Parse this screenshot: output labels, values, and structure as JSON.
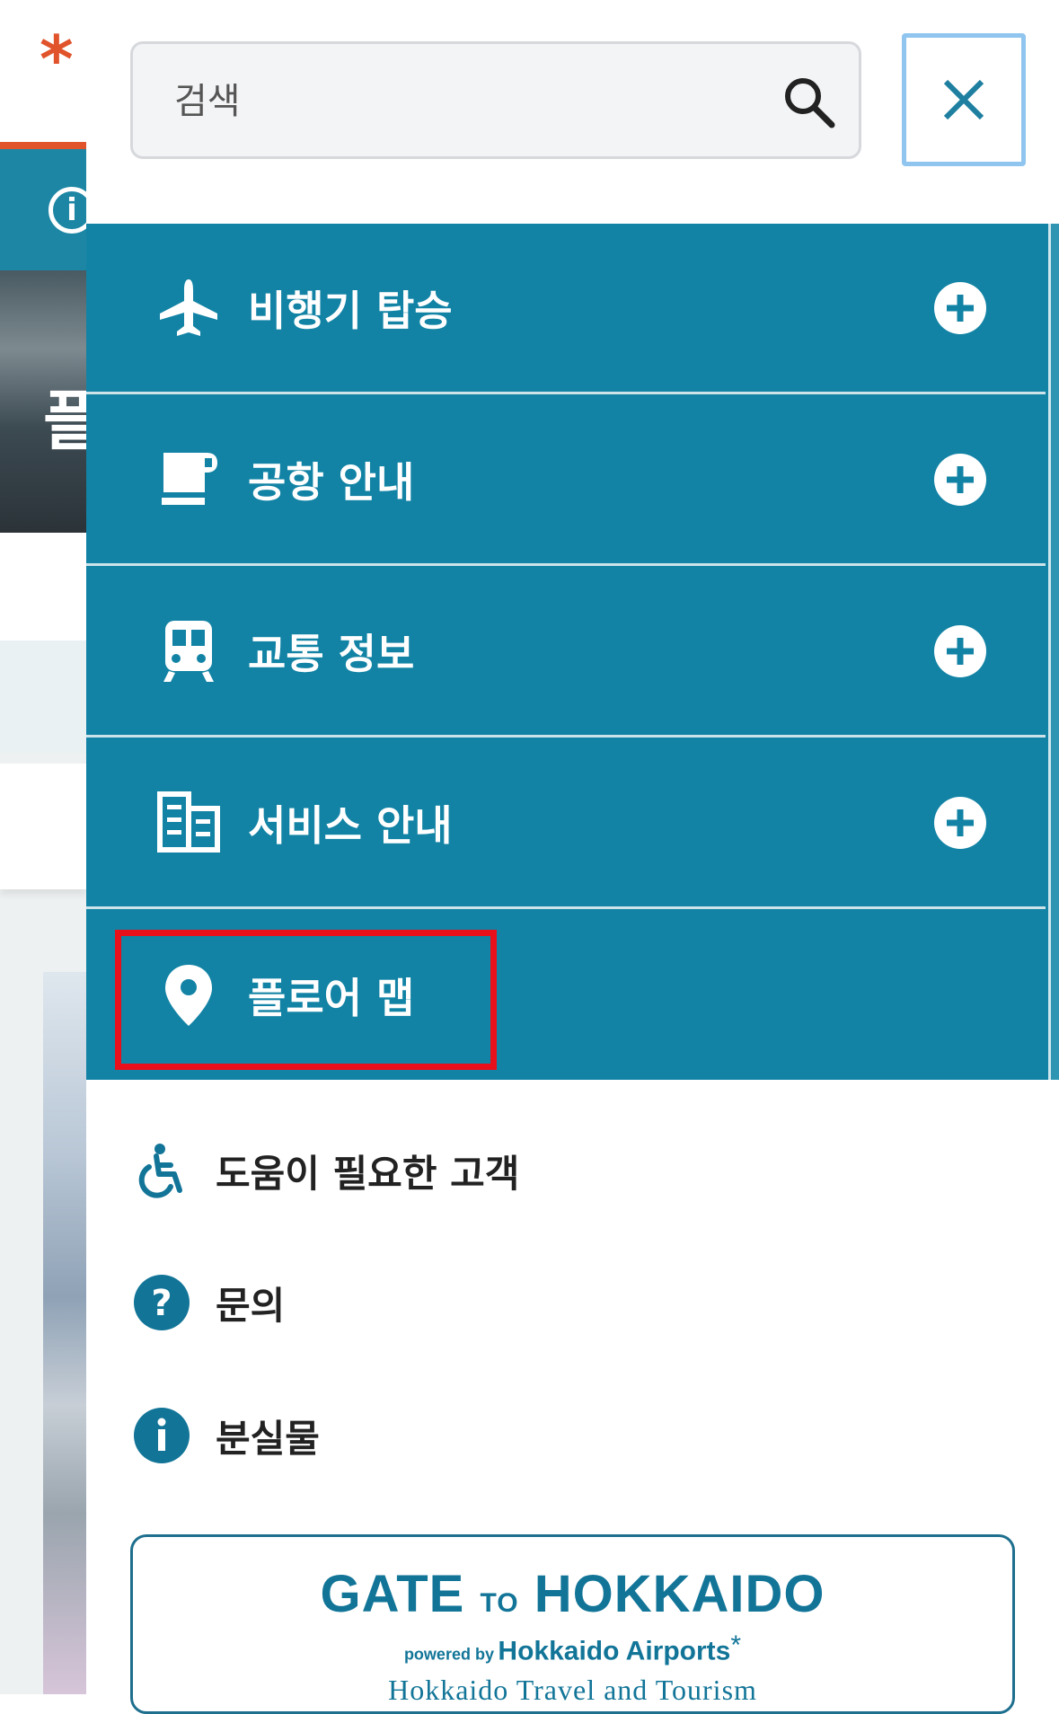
{
  "background": {
    "logo_symbol": "*",
    "info_symbol": "i",
    "heading_fragment": "플"
  },
  "search": {
    "placeholder": "검색",
    "icon": "search-icon"
  },
  "close": {
    "icon": "close-icon"
  },
  "menu": {
    "items": [
      {
        "label": "비행기 탑승",
        "icon": "airplane-icon"
      },
      {
        "label": "공항 안내",
        "icon": "coffee-cup-icon"
      },
      {
        "label": "교통 정보",
        "icon": "train-icon"
      },
      {
        "label": "서비스 안내",
        "icon": "building-icon"
      },
      {
        "label": "플로어 맵",
        "icon": "map-pin-icon"
      }
    ],
    "expand_icon": "plus-circle-icon"
  },
  "links": [
    {
      "label": "도움이 필요한 고객",
      "icon": "wheelchair-icon"
    },
    {
      "label": "문의",
      "icon": "question-icon"
    },
    {
      "label": "분실물",
      "icon": "info-icon"
    }
  ],
  "banner": {
    "title_gate": "GATE",
    "title_to": "TO",
    "title_hokkaido": "HOKKAIDO",
    "powered_by": "powered by",
    "airports": "Hokkaido Airports",
    "asterisk": "*",
    "tagline": "Hokkaido Travel and Tourism"
  },
  "colors": {
    "menu_bg": "#1283a5",
    "accent_orange": "#e0532b",
    "highlight_red": "#e8101a",
    "brand_teal": "#127598"
  }
}
